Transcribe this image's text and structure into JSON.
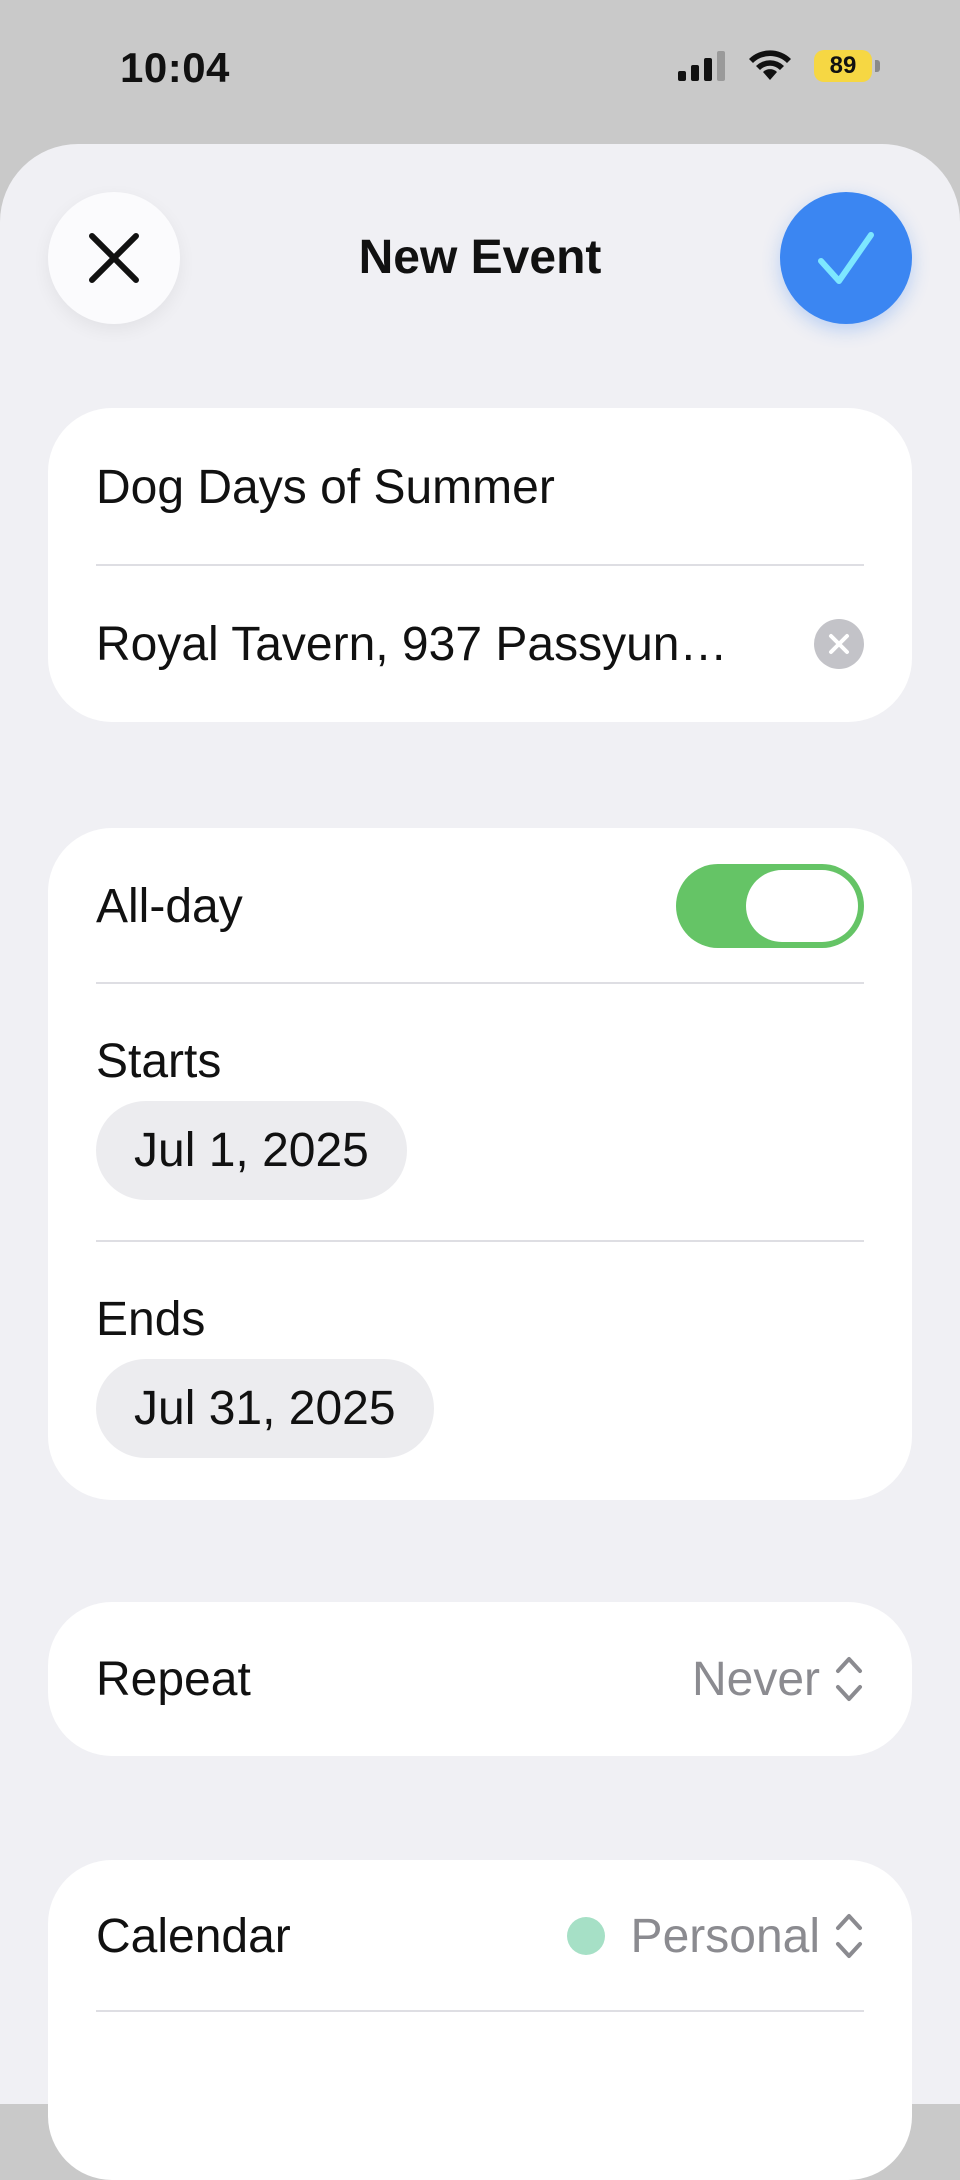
{
  "status_bar": {
    "time": "10:04",
    "battery": "89"
  },
  "header": {
    "title": "New Event"
  },
  "event": {
    "title_value": "Dog Days of Summer",
    "location_value": "Royal Tavern, 937 Passyun…"
  },
  "dates": {
    "all_day_label": "All-day",
    "all_day_on": true,
    "starts_label": "Starts",
    "starts_value": "Jul 1, 2025",
    "ends_label": "Ends",
    "ends_value": "Jul 31, 2025"
  },
  "repeat": {
    "label": "Repeat",
    "value": "Never"
  },
  "calendar": {
    "label": "Calendar",
    "value": "Personal",
    "color": "#a6e0c6"
  },
  "colors": {
    "accent": "#3b86f2",
    "toggle_on": "#65c466"
  }
}
